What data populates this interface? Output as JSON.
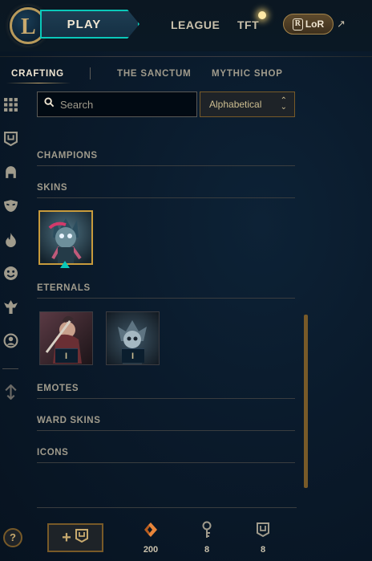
{
  "topbar": {
    "logo_letter": "L",
    "play_label": "PLAY",
    "league_label": "LEAGUE",
    "tft_label": "TFT",
    "lor_label": "LoR",
    "lor_badge": "R",
    "external_icon": "external-link-icon"
  },
  "subnav": {
    "items": [
      {
        "label": "CRAFTING",
        "active": true
      },
      {
        "label": "THE SANCTUM",
        "active": false
      },
      {
        "label": "MYTHIC SHOP",
        "active": false
      }
    ]
  },
  "rail": {
    "icons": [
      "grid-icon",
      "chest-icon",
      "helmet-icon",
      "mask-icon",
      "flame-icon",
      "emote-icon",
      "ward-icon",
      "profile-icon",
      "collapse-arrows-icon"
    ]
  },
  "search": {
    "placeholder": "Search"
  },
  "sort": {
    "selected": "Alphabetical"
  },
  "sections": {
    "champions": "CHAMPIONS",
    "skins": "SKINS",
    "eternals": "ETERNALS",
    "emotes": "EMOTES",
    "ward_skins": "WARD SKINS",
    "icons": "ICONS"
  },
  "eternals": [
    {
      "badge": "I"
    },
    {
      "badge": "I"
    }
  ],
  "footer": {
    "help_label": "?",
    "add_label": "+",
    "currencies": [
      {
        "icon": "orange-essence-icon",
        "value": "200"
      },
      {
        "icon": "key-fragment-icon",
        "value": "8"
      },
      {
        "icon": "chest-icon",
        "value": "8"
      }
    ]
  },
  "colors": {
    "gold": "#c8aa6e",
    "teal": "#0ac8b9",
    "background": "#0a1a2b"
  }
}
